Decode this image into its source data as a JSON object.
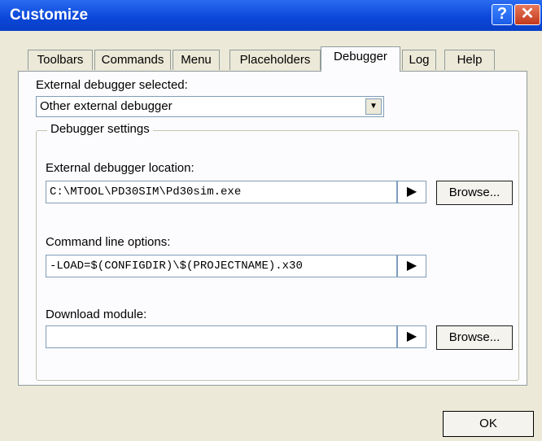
{
  "window": {
    "title": "Customize",
    "help_glyph": "?",
    "close_glyph": "✕"
  },
  "tabs": [
    {
      "label": "Toolbars"
    },
    {
      "label": "Commands"
    },
    {
      "label": "Menu"
    },
    {
      "label": "Placeholders"
    },
    {
      "label": "Debugger"
    },
    {
      "label": "Log"
    },
    {
      "label": "Help"
    }
  ],
  "active_tab": "Debugger",
  "debugger": {
    "selected_label": "External debugger selected:",
    "selected_value": "Other external debugger",
    "group_title": "Debugger settings",
    "location_label": "External debugger location:",
    "location_value": "C:\\MTOOL\\PD30SIM\\Pd30sim.exe",
    "options_label": "Command line options:",
    "options_value": "-LOAD=$(CONFIGDIR)\\$(PROJECTNAME).x30",
    "download_label": "Download module:",
    "download_value": "",
    "browse_label": "Browse...",
    "arrow_glyph": "▶"
  },
  "footer": {
    "ok_label": "OK"
  },
  "icons": {
    "dropdown": "chevron-down-icon",
    "arrow": "play-arrow-icon"
  }
}
